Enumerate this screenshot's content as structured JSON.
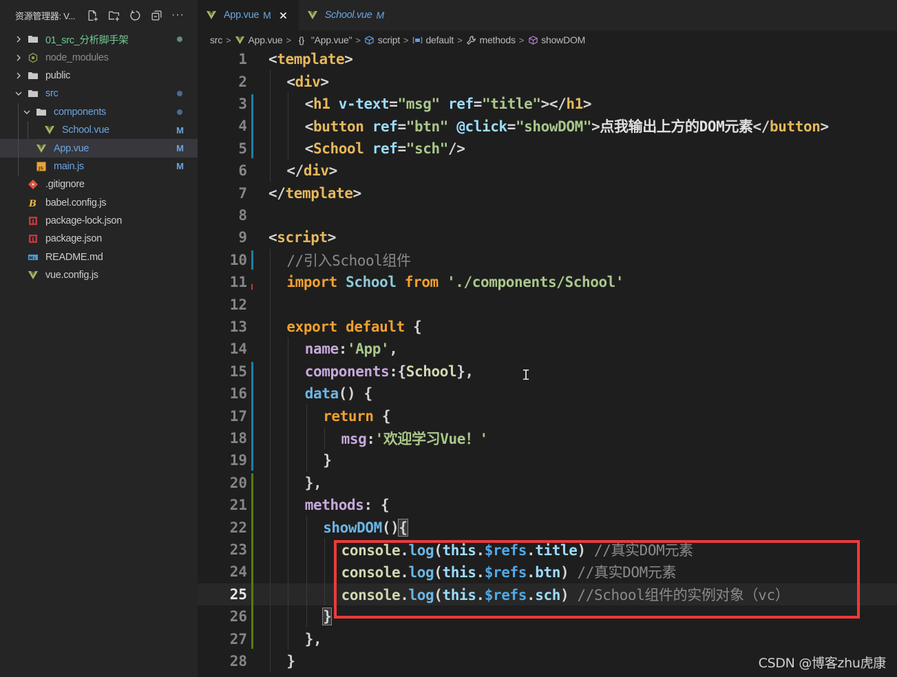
{
  "sidebar": {
    "title": "资源管理器: V...",
    "actions": [
      {
        "name": "new-file",
        "icon": "new-file-icon"
      },
      {
        "name": "new-folder",
        "icon": "new-folder-icon"
      },
      {
        "name": "refresh",
        "icon": "refresh-icon"
      },
      {
        "name": "collapse-all",
        "icon": "collapse-all-icon"
      },
      {
        "name": "more",
        "icon": "more-icon",
        "glyph": "···"
      }
    ],
    "tree": [
      {
        "label": "01_src_分析脚手架",
        "type": "folder",
        "expanded": false,
        "depth": 0,
        "color": "#73c991",
        "status": "dot",
        "status_color": "#5f8f70"
      },
      {
        "label": "node_modules",
        "type": "folder-node",
        "expanded": false,
        "depth": 0,
        "color": "#8b8b8b"
      },
      {
        "label": "public",
        "type": "folder",
        "expanded": false,
        "depth": 0,
        "color": "#cccccc"
      },
      {
        "label": "src",
        "type": "folder",
        "expanded": true,
        "depth": 0,
        "color": "#6ba6e0",
        "status": "dot",
        "status_color": "#4b6a8f"
      },
      {
        "label": "components",
        "type": "folder",
        "expanded": true,
        "depth": 1,
        "color": "#6ba6e0",
        "status": "dot",
        "status_color": "#4b6a8f"
      },
      {
        "label": "School.vue",
        "type": "vue",
        "depth": 2,
        "color": "#6ba6e0",
        "status": "M"
      },
      {
        "label": "App.vue",
        "type": "vue",
        "depth": 1,
        "color": "#6ba6e0",
        "status": "M",
        "selected": true
      },
      {
        "label": "main.js",
        "type": "js",
        "depth": 1,
        "color": "#6ba6e0",
        "status": "M"
      },
      {
        "label": ".gitignore",
        "type": "git",
        "depth": 0,
        "color": "#cccccc"
      },
      {
        "label": "babel.config.js",
        "type": "babel",
        "depth": 0,
        "color": "#cccccc"
      },
      {
        "label": "package-lock.json",
        "type": "npm",
        "depth": 0,
        "color": "#cccccc"
      },
      {
        "label": "package.json",
        "type": "npm",
        "depth": 0,
        "color": "#cccccc"
      },
      {
        "label": "README.md",
        "type": "md",
        "depth": 0,
        "color": "#cccccc"
      },
      {
        "label": "vue.config.js",
        "type": "vue",
        "depth": 0,
        "color": "#cccccc"
      }
    ]
  },
  "tabs": [
    {
      "label": "App.vue",
      "modified": "M",
      "active": true,
      "close": "×"
    },
    {
      "label": "School.vue",
      "modified": "M",
      "active": false,
      "preview": true
    }
  ],
  "breadcrumb": [
    {
      "label": "src",
      "icon": null
    },
    {
      "label": "App.vue",
      "icon": "vue-icon"
    },
    {
      "label": "\"App.vue\"",
      "icon": "braces-icon",
      "glyph": "{}"
    },
    {
      "label": "script",
      "icon": "cube-icon"
    },
    {
      "label": "default",
      "icon": "variable-icon"
    },
    {
      "label": "methods",
      "icon": "wrench-icon"
    },
    {
      "label": "showDOM",
      "icon": "method-cube-icon"
    }
  ],
  "editor": {
    "current_line": 25,
    "lines": [
      {
        "n": 1,
        "indent": 0,
        "tokens": [
          [
            "t-br",
            "<"
          ],
          [
            "t-tag",
            "template"
          ],
          [
            "t-br",
            ">"
          ]
        ]
      },
      {
        "n": 2,
        "indent": 1,
        "tokens": [
          [
            "t-br",
            "<"
          ],
          [
            "t-tag",
            "div"
          ],
          [
            "t-br",
            ">"
          ]
        ]
      },
      {
        "n": 3,
        "indent": 2,
        "tokens": [
          [
            "t-br",
            "<"
          ],
          [
            "t-tag",
            "h1"
          ],
          [
            "t-text",
            " "
          ],
          [
            "t-attr",
            "v-text"
          ],
          [
            "t-punc",
            "="
          ],
          [
            "t-str",
            "\"msg\""
          ],
          [
            "t-text",
            " "
          ],
          [
            "t-attr",
            "ref"
          ],
          [
            "t-punc",
            "="
          ],
          [
            "t-str",
            "\"title\""
          ],
          [
            "t-br",
            "></"
          ],
          [
            "t-tag",
            "h1"
          ],
          [
            "t-br",
            ">"
          ]
        ]
      },
      {
        "n": 4,
        "indent": 2,
        "tokens": [
          [
            "t-br",
            "<"
          ],
          [
            "t-tag",
            "button"
          ],
          [
            "t-text",
            " "
          ],
          [
            "t-attr",
            "ref"
          ],
          [
            "t-punc",
            "="
          ],
          [
            "t-str",
            "\"btn\""
          ],
          [
            "t-text",
            " "
          ],
          [
            "t-attr",
            "@click"
          ],
          [
            "t-punc",
            "="
          ],
          [
            "t-str",
            "\"showDOM\""
          ],
          [
            "t-br",
            ">"
          ],
          [
            "t-text",
            "点我输出上方的DOM元素"
          ],
          [
            "t-br",
            "</"
          ],
          [
            "t-tag",
            "button"
          ],
          [
            "t-br",
            ">"
          ]
        ]
      },
      {
        "n": 5,
        "indent": 2,
        "tokens": [
          [
            "t-br",
            "<"
          ],
          [
            "t-tag",
            "School"
          ],
          [
            "t-text",
            " "
          ],
          [
            "t-attr",
            "ref"
          ],
          [
            "t-punc",
            "="
          ],
          [
            "t-str",
            "\"sch\""
          ],
          [
            "t-br",
            "/>"
          ]
        ]
      },
      {
        "n": 6,
        "indent": 1,
        "tokens": [
          [
            "t-br",
            "</"
          ],
          [
            "t-tag",
            "div"
          ],
          [
            "t-br",
            ">"
          ]
        ]
      },
      {
        "n": 7,
        "indent": 0,
        "tokens": [
          [
            "t-br",
            "</"
          ],
          [
            "t-tag",
            "template"
          ],
          [
            "t-br",
            ">"
          ]
        ]
      },
      {
        "n": 8,
        "indent": 0,
        "tokens": []
      },
      {
        "n": 9,
        "indent": 0,
        "tokens": [
          [
            "t-br",
            "<"
          ],
          [
            "t-tag",
            "script"
          ],
          [
            "t-br",
            ">"
          ]
        ]
      },
      {
        "n": 10,
        "indent": 1,
        "tokens": [
          [
            "t-cmt",
            "//引入School组件"
          ]
        ]
      },
      {
        "n": 11,
        "indent": 1,
        "tokens": [
          [
            "t-kw",
            "import"
          ],
          [
            "t-text",
            " "
          ],
          [
            "t-cls",
            "School"
          ],
          [
            "t-text",
            " "
          ],
          [
            "t-kw",
            "from"
          ],
          [
            "t-text",
            " "
          ],
          [
            "t-str",
            "'./components/School'"
          ]
        ]
      },
      {
        "n": 12,
        "indent": 0,
        "tokens": []
      },
      {
        "n": 13,
        "indent": 1,
        "tokens": [
          [
            "t-kw",
            "export"
          ],
          [
            "t-text",
            " "
          ],
          [
            "t-kw",
            "default"
          ],
          [
            "t-text",
            " "
          ],
          [
            "t-punc",
            "{"
          ]
        ]
      },
      {
        "n": 14,
        "indent": 2,
        "tokens": [
          [
            "t-prop",
            "name"
          ],
          [
            "t-punc",
            ":"
          ],
          [
            "t-str",
            "'App'"
          ],
          [
            "t-punc",
            ","
          ]
        ]
      },
      {
        "n": 15,
        "indent": 2,
        "tokens": [
          [
            "t-prop",
            "components"
          ],
          [
            "t-punc",
            ":{"
          ],
          [
            "t-var",
            "School"
          ],
          [
            "t-punc",
            "},"
          ]
        ]
      },
      {
        "n": 16,
        "indent": 2,
        "tokens": [
          [
            "t-fn",
            "data"
          ],
          [
            "t-punc",
            "() {"
          ]
        ]
      },
      {
        "n": 17,
        "indent": 3,
        "tokens": [
          [
            "t-kw",
            "return"
          ],
          [
            "t-text",
            " "
          ],
          [
            "t-punc",
            "{"
          ]
        ]
      },
      {
        "n": 18,
        "indent": 4,
        "tokens": [
          [
            "t-prop",
            "msg"
          ],
          [
            "t-punc",
            ":"
          ],
          [
            "t-str",
            "'欢迎学习Vue！'"
          ]
        ]
      },
      {
        "n": 19,
        "indent": 3,
        "tokens": [
          [
            "t-punc",
            "}"
          ]
        ]
      },
      {
        "n": 20,
        "indent": 2,
        "tokens": [
          [
            "t-punc",
            "},"
          ]
        ]
      },
      {
        "n": 21,
        "indent": 2,
        "tokens": [
          [
            "t-prop",
            "methods"
          ],
          [
            "t-punc",
            ": {"
          ]
        ]
      },
      {
        "n": 22,
        "indent": 3,
        "tokens": [
          [
            "t-fn",
            "showDOM"
          ],
          [
            "t-punc",
            "()"
          ],
          [
            "bracket-hl",
            "{"
          ]
        ]
      },
      {
        "n": 23,
        "indent": 4,
        "tokens": [
          [
            "t-var",
            "console"
          ],
          [
            "t-punc",
            "."
          ],
          [
            "t-fn",
            "log"
          ],
          [
            "t-punc",
            "("
          ],
          [
            "t-this",
            "this"
          ],
          [
            "t-punc",
            "."
          ],
          [
            "t-ref",
            "$refs"
          ],
          [
            "t-punc",
            "."
          ],
          [
            "t-this",
            "title"
          ],
          [
            "t-punc",
            ")"
          ],
          [
            "t-text",
            " "
          ],
          [
            "t-cmt",
            "//真实DOM元素"
          ]
        ]
      },
      {
        "n": 24,
        "indent": 4,
        "tokens": [
          [
            "t-var",
            "console"
          ],
          [
            "t-punc",
            "."
          ],
          [
            "t-fn",
            "log"
          ],
          [
            "t-punc",
            "("
          ],
          [
            "t-this",
            "this"
          ],
          [
            "t-punc",
            "."
          ],
          [
            "t-ref",
            "$refs"
          ],
          [
            "t-punc",
            "."
          ],
          [
            "t-this",
            "btn"
          ],
          [
            "t-punc",
            ")"
          ],
          [
            "t-text",
            " "
          ],
          [
            "t-cmt",
            "//真实DOM元素"
          ]
        ]
      },
      {
        "n": 25,
        "indent": 4,
        "tokens": [
          [
            "t-var",
            "console"
          ],
          [
            "t-punc",
            "."
          ],
          [
            "t-fn",
            "log"
          ],
          [
            "t-punc",
            "("
          ],
          [
            "t-this",
            "this"
          ],
          [
            "t-punc",
            "."
          ],
          [
            "t-ref",
            "$refs"
          ],
          [
            "t-punc",
            "."
          ],
          [
            "t-this",
            "sch"
          ],
          [
            "t-punc",
            ")"
          ],
          [
            "t-text",
            " "
          ],
          [
            "t-cmt",
            "//School组件的实例对象（vc）"
          ]
        ]
      },
      {
        "n": 26,
        "indent": 3,
        "tokens": [
          [
            "bracket-hl",
            "}"
          ]
        ]
      },
      {
        "n": 27,
        "indent": 2,
        "tokens": [
          [
            "t-punc",
            "},"
          ]
        ]
      },
      {
        "n": 28,
        "indent": 1,
        "tokens": [
          [
            "t-punc",
            "}"
          ]
        ]
      }
    ]
  },
  "annotation": {
    "highlight_color": "#ee3a3a",
    "covers_lines": [
      23,
      24,
      25
    ]
  },
  "watermark": "CSDN @博客zhu虎康"
}
